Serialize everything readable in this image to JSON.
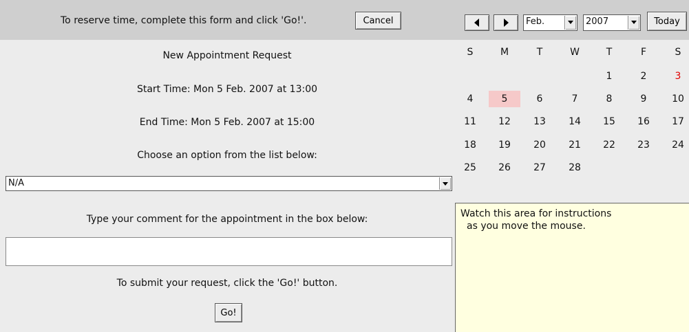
{
  "header": {
    "instruction": "To reserve time, complete this form and click 'Go!'.",
    "cancel_label": "Cancel"
  },
  "calendar_nav": {
    "prev_icon": "left-triangle",
    "next_icon": "right-triangle",
    "month_value": "Feb.",
    "year_value": "2007",
    "today_label": "Today"
  },
  "calendar": {
    "weekdays": [
      "S",
      "M",
      "T",
      "W",
      "T",
      "F",
      "S"
    ],
    "weeks": [
      [
        "",
        "",
        "",
        "",
        "1",
        "2",
        "3"
      ],
      [
        "4",
        "5",
        "6",
        "7",
        "8",
        "9",
        "10"
      ],
      [
        "11",
        "12",
        "13",
        "14",
        "15",
        "16",
        "17"
      ],
      [
        "18",
        "19",
        "20",
        "21",
        "22",
        "23",
        "24"
      ],
      [
        "25",
        "26",
        "27",
        "28",
        "",
        "",
        ""
      ]
    ],
    "selected_day": "5",
    "highlight_color": "#f6c9c9",
    "red_day": "3",
    "red_color": "#e00000"
  },
  "form": {
    "title": "New Appointment Request",
    "start_time": "Start Time: Mon 5 Feb. 2007 at 13:00",
    "end_time": "End Time: Mon 5 Feb. 2007 at 15:00",
    "choose_label": "Choose an option from the list below:",
    "option_value": "N/A",
    "comment_label": "Type your comment for the appointment in the box below:",
    "comment_value": "",
    "submit_text": "To submit your request, click the 'Go!' button.",
    "go_label": "Go!"
  },
  "instructions": {
    "line1": "Watch this area for instructions",
    "line2": "as you move the mouse."
  }
}
